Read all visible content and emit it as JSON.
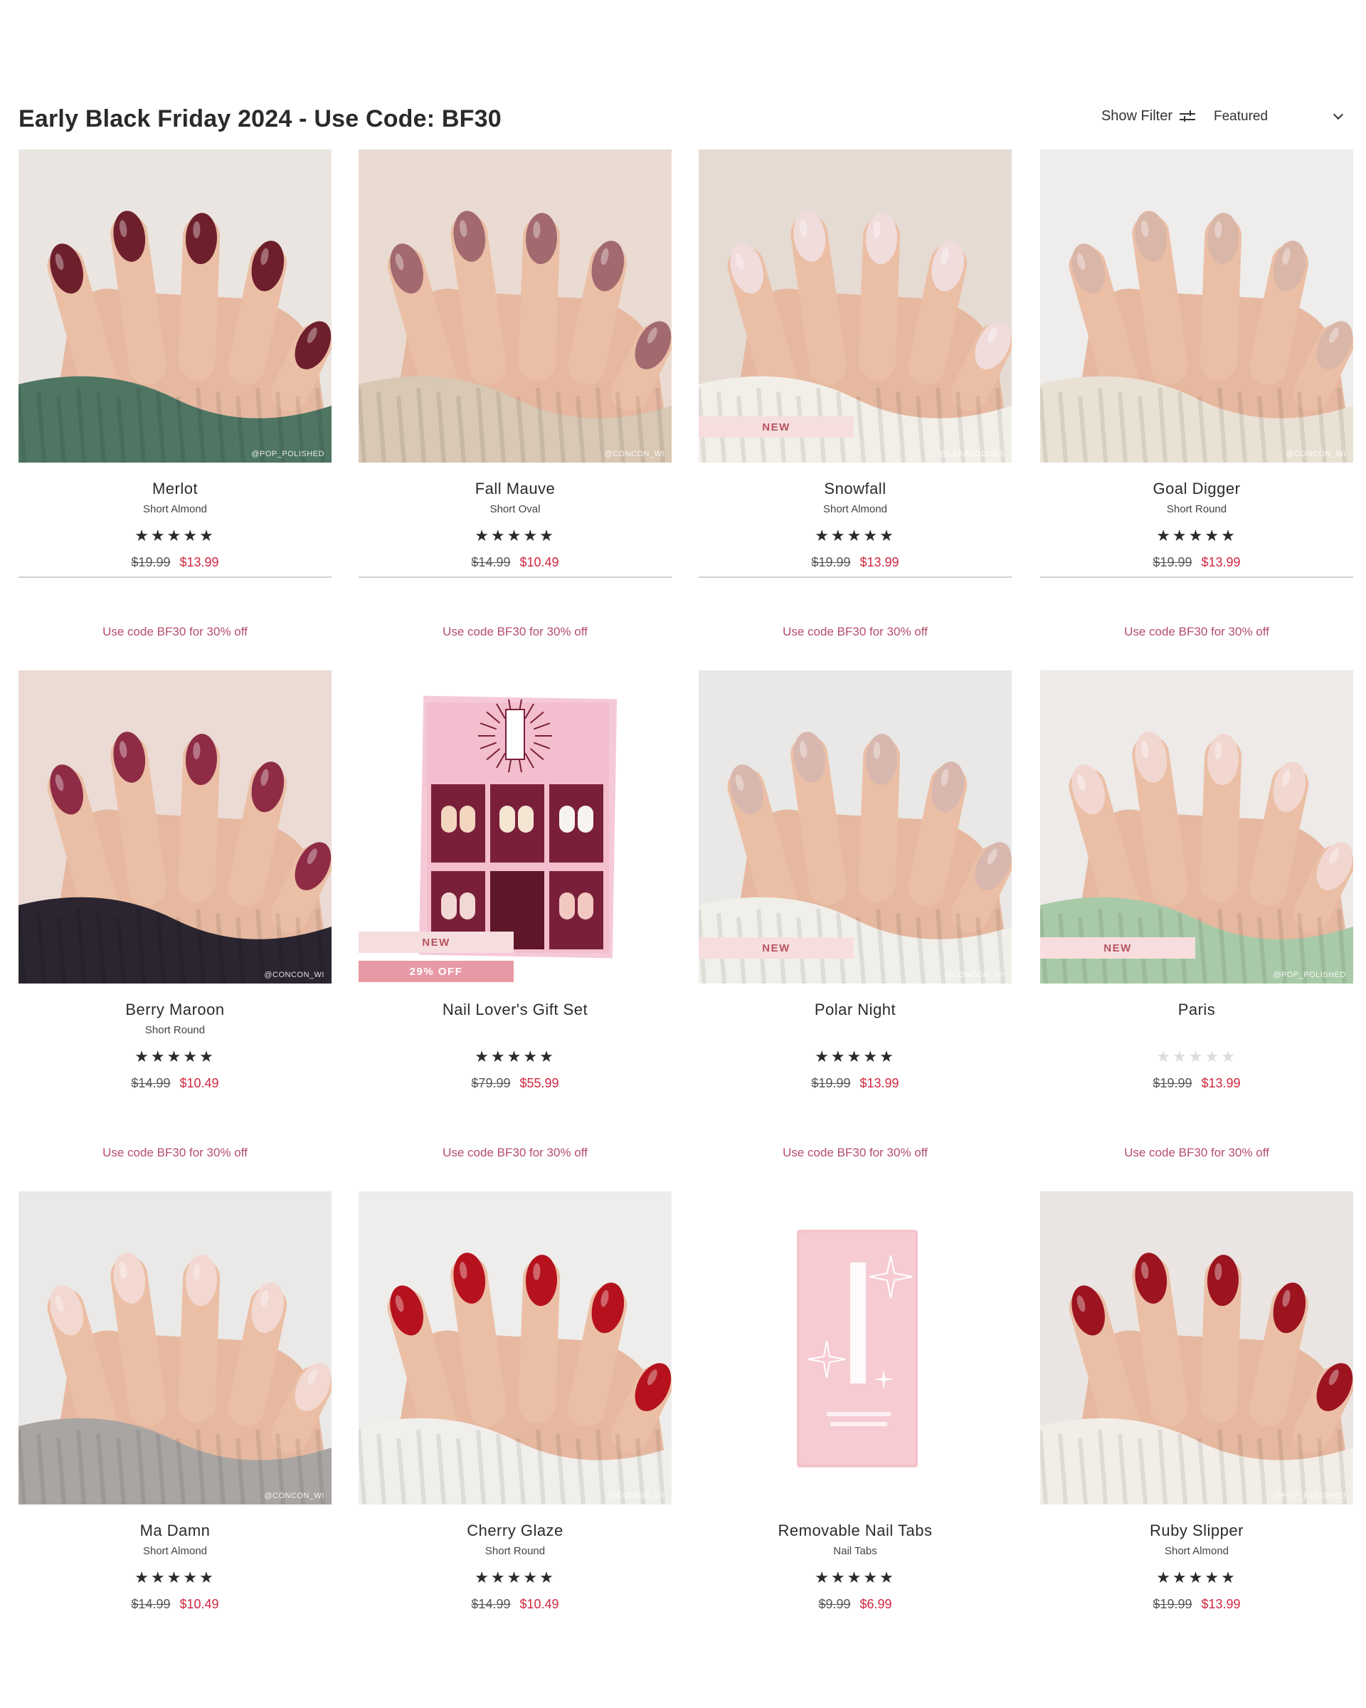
{
  "header": {
    "title": "Early Black Friday 2024 - Use Code: BF30",
    "show_filter_label": "Show Filter",
    "sort_label": "Featured"
  },
  "products": [
    {
      "name": "Merlot",
      "shape": "Short Almond",
      "rating": 4.5,
      "old_price": "$19.99",
      "new_price": "$13.99",
      "promo": "Use code BF30 for 30% off",
      "badge": "",
      "badge2": "",
      "watermark": "@POP_POLISHED",
      "nail_color": "#6e1f2c",
      "bg_color": "#e8e2dc",
      "sleeve_color": "#4f7563"
    },
    {
      "name": "Fall Mauve",
      "shape": "Short Oval",
      "rating": 5,
      "old_price": "$14.99",
      "new_price": "$10.49",
      "promo": "Use code BF30 for 30% off",
      "badge": "",
      "badge2": "",
      "watermark": "@CONCON_WI",
      "nail_color": "#a26a6f",
      "bg_color": "#e8d7cc",
      "sleeve_color": "#d8c8b4"
    },
    {
      "name": "Snowfall",
      "shape": "Short Almond",
      "rating": 5,
      "old_price": "$19.99",
      "new_price": "$13.99",
      "promo": "Use code BF30 for 30% off",
      "badge": "NEW",
      "badge2": "",
      "watermark": "@LEABEDDOES",
      "nail_color": "#f1dcdc",
      "bg_color": "#e2d7cd",
      "sleeve_color": "#f2efe8"
    },
    {
      "name": "Goal Digger",
      "shape": "Short Round",
      "rating": 4.5,
      "old_price": "$19.99",
      "new_price": "$13.99",
      "promo": "Use code BF30 for 30% off",
      "badge": "",
      "badge2": "",
      "watermark": "@CONCON_WI",
      "nail_color": "#d9b6a8",
      "bg_color": "#ecebea",
      "sleeve_color": "#e9e2d4"
    },
    {
      "name": "Berry Maroon",
      "shape": "Short Round",
      "rating": 4.5,
      "old_price": "$14.99",
      "new_price": "$10.49",
      "promo": "Use code BF30 for 30% off",
      "badge": "",
      "badge2": "",
      "watermark": "@CONCON_WI",
      "nail_color": "#8e2c45",
      "bg_color": "#e9d6cf",
      "sleeve_color": "#2a2530"
    },
    {
      "name": "Nail Lover's Gift Set",
      "shape": "",
      "rating": 5,
      "old_price": "$79.99",
      "new_price": "$55.99",
      "promo": "Use code BF30 for 30% off",
      "badge": "NEW",
      "badge2": "29% OFF",
      "watermark": "",
      "nail_color": "#7a1f3a",
      "bg_color": "#ffffff",
      "sleeve_color": "#f4c7d3"
    },
    {
      "name": "Polar Night",
      "shape": "",
      "rating": 5,
      "old_price": "$19.99",
      "new_price": "$13.99",
      "promo": "Use code BF30 for 30% off",
      "badge": "NEW",
      "badge2": "",
      "watermark": "@CONCON_WI",
      "nail_color": "#d7b7ae",
      "bg_color": "#e6e5e3",
      "sleeve_color": "#f1efe9"
    },
    {
      "name": "Paris",
      "shape": "",
      "rating": 0,
      "old_price": "$19.99",
      "new_price": "$13.99",
      "promo": "Use code BF30 for 30% off",
      "badge": "NEW",
      "badge2": "",
      "watermark": "@POP_POLISHED",
      "nail_color": "#f1d7cf",
      "bg_color": "#ebe8e5",
      "sleeve_color": "#a9caa8"
    },
    {
      "name": "Ma Damn",
      "shape": "Short Almond",
      "rating": 4.5,
      "old_price": "$14.99",
      "new_price": "$10.49",
      "promo": "",
      "badge": "",
      "badge2": "",
      "watermark": "@CONCON_WI",
      "nail_color": "#f2d8d0",
      "bg_color": "#e8e6e4",
      "sleeve_color": "#a9a5a2"
    },
    {
      "name": "Cherry Glaze",
      "shape": "Short Round",
      "rating": 4.5,
      "old_price": "$14.99",
      "new_price": "$10.49",
      "promo": "",
      "badge": "",
      "badge2": "",
      "watermark": "@CONNIE_WI",
      "nail_color": "#b5121d",
      "bg_color": "#ecebe9",
      "sleeve_color": "#f1efec"
    },
    {
      "name": "Removable Nail Tabs",
      "shape": "Nail Tabs",
      "rating": 4.5,
      "old_price": "$9.99",
      "new_price": "$6.99",
      "promo": "",
      "badge": "",
      "badge2": "",
      "watermark": "",
      "nail_color": "#f4c6cf",
      "bg_color": "#ffffff",
      "sleeve_color": "#f4c6cf"
    },
    {
      "name": "Ruby Slipper",
      "shape": "Short Almond",
      "rating": 5,
      "old_price": "$19.99",
      "new_price": "$13.99",
      "promo": "",
      "badge": "",
      "badge2": "",
      "watermark": "@POP_POLISHED",
      "nail_color": "#9c1420",
      "bg_color": "#e7e2de",
      "sleeve_color": "#f2eee7"
    }
  ]
}
